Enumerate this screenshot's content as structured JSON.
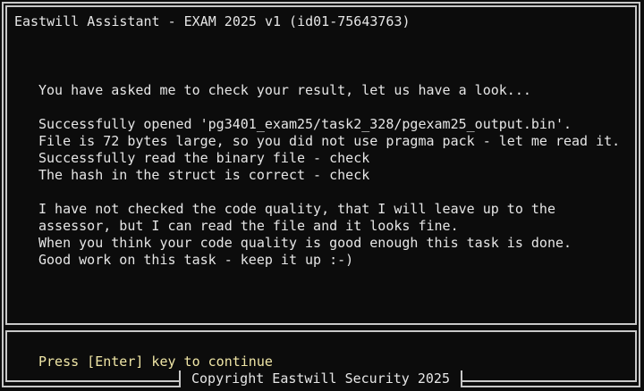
{
  "window": {
    "title": "Eastwill Assistant - EXAM 2025 v1 (id01-75643763)"
  },
  "messages": [
    "You have asked me to check your result, let us have a look...",
    "",
    "Successfully opened 'pg3401_exam25/task2_328/pgexam25_output.bin'.",
    "File is 72 bytes large, so you did not use pragma pack - let me read it.",
    "Successfully read the binary file - check",
    "The hash in the struct is correct - check",
    "",
    "I have not checked the code quality, that I will leave up to the",
    "assessor, but I can read the file and it looks fine.",
    "When you think your code quality is good enough this task is done.",
    "Good work on this task - keep it up :-)"
  ],
  "footer": {
    "prompt": "Press [Enter] key to continue",
    "copyright": "Copyright Eastwill Security 2025"
  }
}
